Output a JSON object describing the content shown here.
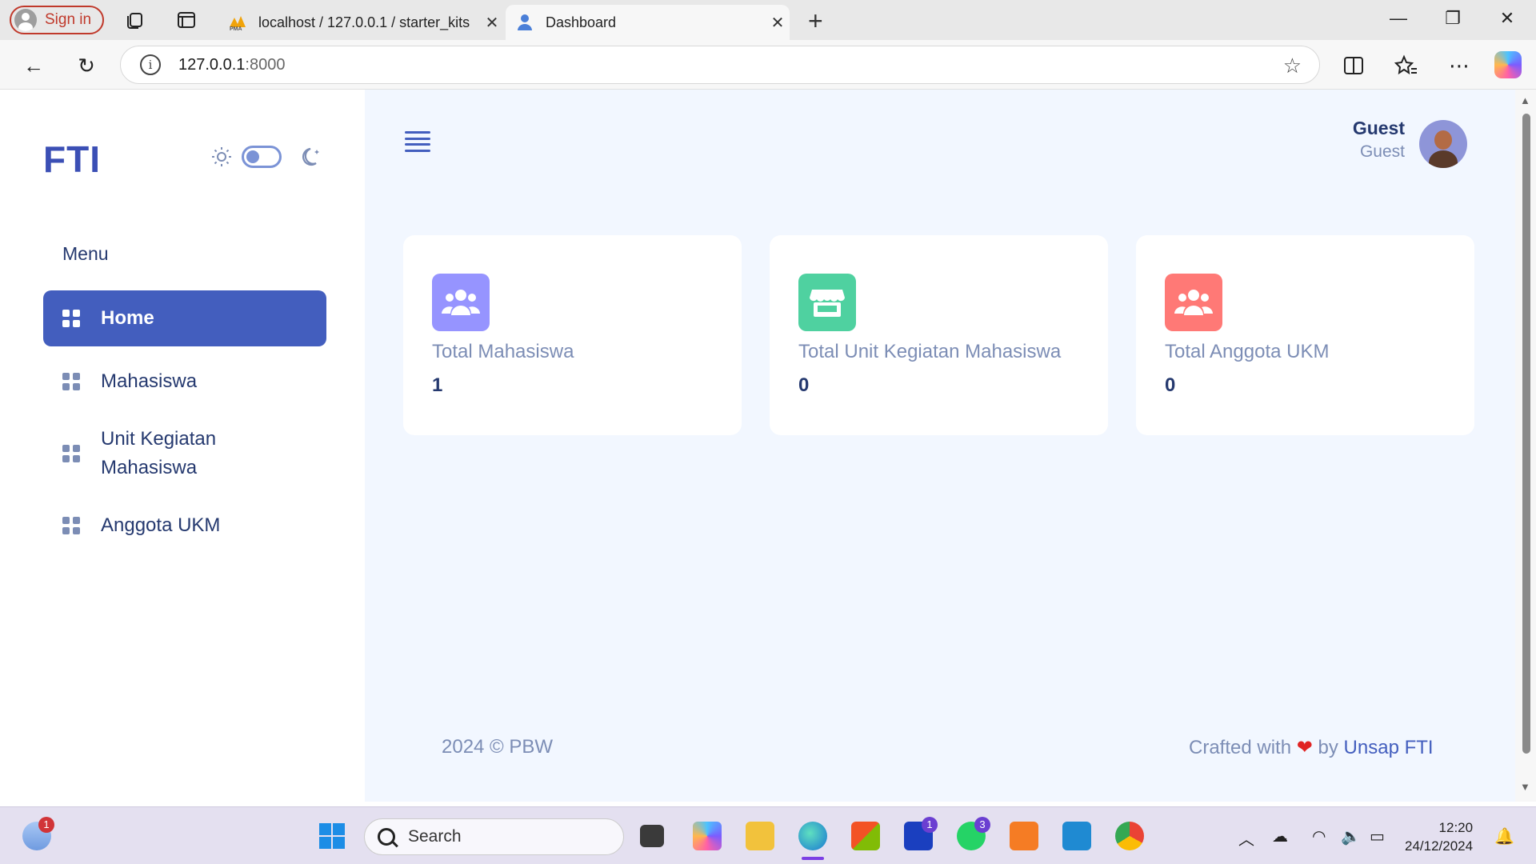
{
  "browser": {
    "signin_label": "Sign in",
    "tabs": [
      {
        "title": "localhost / 127.0.0.1 / starter_kits",
        "favicon": "phpmyadmin-icon"
      },
      {
        "title": "Dashboard",
        "favicon": "user-icon"
      }
    ],
    "url_host": "127.0.0.1",
    "url_port": ":8000"
  },
  "sidebar": {
    "logo": "FTI",
    "menu_title": "Menu",
    "items": [
      {
        "label": "Home",
        "active": true
      },
      {
        "label": "Mahasiswa",
        "active": false
      },
      {
        "label": "Unit Kegiatan Mahasiswa",
        "active": false
      },
      {
        "label": "Anggota UKM",
        "active": false
      }
    ]
  },
  "header": {
    "user_name": "Guest",
    "user_role": "Guest"
  },
  "cards": [
    {
      "label": "Total Mahasiswa",
      "value": "1",
      "icon": "users-icon",
      "color": "#9694ff"
    },
    {
      "label": "Total Unit Kegiatan Mahasiswa",
      "value": "0",
      "icon": "store-icon",
      "color": "#57caeb"
    },
    {
      "label": "Total Anggota UKM",
      "value": "0",
      "icon": "users-icon",
      "color": "#ff7976"
    }
  ],
  "footer": {
    "left": "2024 © PBW",
    "crafted_prefix": "Crafted with",
    "crafted_by": "by",
    "crafted_link": "Unsap FTI"
  },
  "taskbar": {
    "search_placeholder": "Search",
    "time": "12:20",
    "date": "24/12/2024",
    "badges": {
      "weather": "1",
      "launcher": "1",
      "whatsapp": "3"
    }
  }
}
